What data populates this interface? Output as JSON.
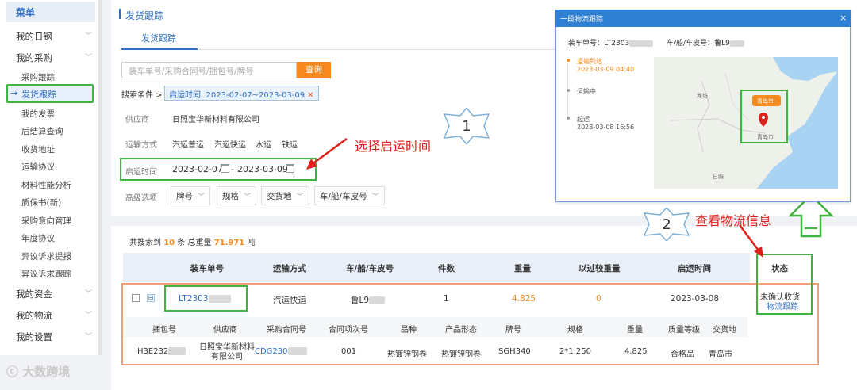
{
  "sidebar": {
    "header": "菜单",
    "groups": [
      {
        "label": "我的日钢"
      },
      {
        "label": "我的采购"
      },
      {
        "label": "我的资金"
      },
      {
        "label": "我的物流"
      },
      {
        "label": "我的设置"
      }
    ],
    "purchase_items": [
      "采购跟踪",
      "发货跟踪",
      "我的发票",
      "后结算查询",
      "收货地址",
      "运输协议",
      "材料性能分析",
      "质保书(新)",
      "采购意向管理",
      "年度协议",
      "异议诉求提报",
      "异议诉求跟踪"
    ],
    "active_item": "发货跟踪"
  },
  "page": {
    "title": "发货跟踪",
    "tab": "发货跟踪",
    "search_placeholder": "装车单号/采购合同号/捆包号/牌号",
    "search_button": "查询",
    "conditions_label": "搜索条件 >",
    "condition_chip": "启运时间: 2023-02-07~2023-03-09",
    "supplier_label": "供应商",
    "supplier_value": "日照宝华新材料有限公司",
    "transport_label": "运输方式",
    "transport_options": [
      "汽运普运",
      "汽运快运",
      "水运",
      "铁运"
    ],
    "date_label": "启运时间",
    "date_from": "2023-02-07",
    "date_sep": "-",
    "date_to": "2023-03-09",
    "advanced_label": "高级选项",
    "advanced_dropdowns": [
      "牌号",
      "规格",
      "交货地",
      "车/船/车皮号"
    ]
  },
  "annotations": {
    "step1_number": "1",
    "step1_text": "选择启运时间",
    "step2_number": "2",
    "step2_text": "查看物流信息"
  },
  "results": {
    "summary_prefix": "共搜索到",
    "count": "10",
    "summary_mid": "条 总重量",
    "total_weight": "71.971",
    "summary_unit": "吨",
    "columns": [
      "装车单号",
      "运输方式",
      "车/船/车皮号",
      "件数",
      "重量",
      "以过较重量",
      "启运时间",
      "状态"
    ],
    "row": {
      "order_no": "LT2303",
      "transport": "汽运快运",
      "vehicle": "鲁L9",
      "pieces": "1",
      "weight": "4.825",
      "diff_weight": "0",
      "ship_date": "2023-03-08",
      "status": "未确认收货",
      "status_link": "物流跟踪"
    },
    "sub_columns": [
      "捆包号",
      "供应商",
      "采购合同号",
      "合同项次号",
      "品种",
      "产品形态",
      "牌号",
      "规格",
      "重量",
      "质量等级",
      "交货地"
    ],
    "sub_row": {
      "bundle": "H3E232",
      "supplier": "日照宝华新材料有限公司",
      "contract": "CDG230",
      "item_no": "001",
      "variety": "热镀锌钢卷",
      "form": "热镀锌钢卷",
      "grade": "SGH340",
      "spec": "2*1,250",
      "weight": "4.825",
      "quality": "合格品",
      "delivery": "青岛市"
    }
  },
  "popup": {
    "title": "一段物流跟踪",
    "close": "×",
    "order_label": "装车单号：LT2303",
    "vehicle_label": "车/船/车皮号：鲁L9",
    "timeline": [
      {
        "status": "运输到达",
        "time": "2023-03-09 04:40"
      },
      {
        "status": "运输中",
        "time": ""
      },
      {
        "status": "起运",
        "time": "2023-03-08 16:56"
      }
    ],
    "map_labels": {
      "weifang": "潍坊",
      "qingdao_tag": "青岛市",
      "qingdao": "青岛市",
      "rizhao": "日照"
    }
  },
  "watermark": "大数跨境",
  "colors": {
    "accent": "#2f6fc4",
    "orange": "#f68a1f",
    "highlight_green": "#3fb43f",
    "callout_red": "#e0211b"
  }
}
